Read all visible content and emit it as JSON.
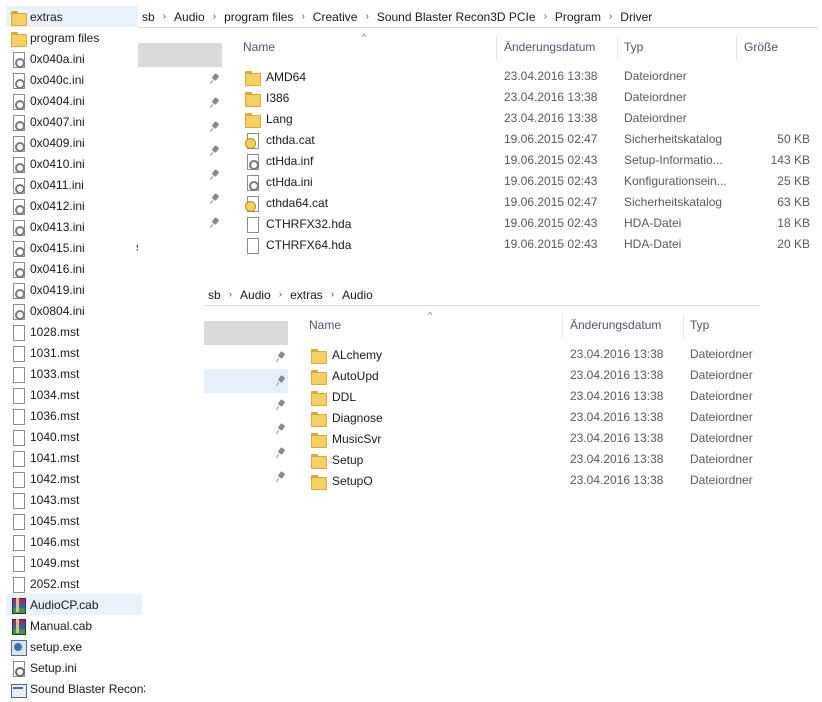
{
  "left_list": {
    "items": [
      {
        "label": "extras",
        "icon": "folder-icon",
        "selected": true
      },
      {
        "label": "program files",
        "icon": "folder-icon"
      },
      {
        "label": "0x040a.ini",
        "icon": "ini-file-icon"
      },
      {
        "label": "0x040c.ini",
        "icon": "ini-file-icon"
      },
      {
        "label": "0x0404.ini",
        "icon": "ini-file-icon"
      },
      {
        "label": "0x0407.ini",
        "icon": "ini-file-icon"
      },
      {
        "label": "0x0409.ini",
        "icon": "ini-file-icon"
      },
      {
        "label": "0x0410.ini",
        "icon": "ini-file-icon"
      },
      {
        "label": "0x0411.ini",
        "icon": "ini-file-icon"
      },
      {
        "label": "0x0412.ini",
        "icon": "ini-file-icon"
      },
      {
        "label": "0x0413.ini",
        "icon": "ini-file-icon"
      },
      {
        "label": "0x0415.ini",
        "icon": "ini-file-icon"
      },
      {
        "label": "0x0416.ini",
        "icon": "ini-file-icon"
      },
      {
        "label": "0x0419.ini",
        "icon": "ini-file-icon"
      },
      {
        "label": "0x0804.ini",
        "icon": "ini-file-icon"
      },
      {
        "label": "1028.mst",
        "icon": "document-icon"
      },
      {
        "label": "1031.mst",
        "icon": "document-icon"
      },
      {
        "label": "1033.mst",
        "icon": "document-icon"
      },
      {
        "label": "1034.mst",
        "icon": "document-icon"
      },
      {
        "label": "1036.mst",
        "icon": "document-icon"
      },
      {
        "label": "1040.mst",
        "icon": "document-icon"
      },
      {
        "label": "1041.mst",
        "icon": "document-icon"
      },
      {
        "label": "1042.mst",
        "icon": "document-icon"
      },
      {
        "label": "1043.mst",
        "icon": "document-icon"
      },
      {
        "label": "1045.mst",
        "icon": "document-icon"
      },
      {
        "label": "1046.mst",
        "icon": "document-icon"
      },
      {
        "label": "1049.mst",
        "icon": "document-icon"
      },
      {
        "label": "2052.mst",
        "icon": "document-icon"
      },
      {
        "label": "AudioCP.cab",
        "icon": "cab-archive-icon",
        "selected": true
      },
      {
        "label": "Manual.cab",
        "icon": "cab-archive-icon"
      },
      {
        "label": "setup.exe",
        "icon": "exe-icon"
      },
      {
        "label": "Setup.ini",
        "icon": "settings-file-icon"
      },
      {
        "label": "Sound Blaster Recon3",
        "icon": "application-icon"
      }
    ],
    "stray_text": "s"
  },
  "explorer_top": {
    "breadcrumb": [
      "sb",
      "Audio",
      "program files",
      "Creative",
      "Sound Blaster Recon3D PCIe",
      "Program",
      "Driver"
    ],
    "columns": {
      "name": "Name",
      "date": "Änderungsdatum",
      "type": "Typ",
      "size": "Größe"
    },
    "sort_indicator": "^",
    "rows": [
      {
        "name": "AMD64",
        "date": "23.04.2016 13:38",
        "type": "Dateiordner",
        "size": "",
        "icon": "folder-icon"
      },
      {
        "name": "I386",
        "date": "23.04.2016 13:38",
        "type": "Dateiordner",
        "size": "",
        "icon": "folder-icon"
      },
      {
        "name": "Lang",
        "date": "23.04.2016 13:38",
        "type": "Dateiordner",
        "size": "",
        "icon": "folder-icon"
      },
      {
        "name": "cthda.cat",
        "date": "19.06.2015 02:47",
        "type": "Sicherheitskatalog",
        "size": "50 KB",
        "icon": "security-catalog-icon"
      },
      {
        "name": "ctHda.inf",
        "date": "19.06.2015 02:43",
        "type": "Setup-Informatio...",
        "size": "143 KB",
        "icon": "inf-file-icon"
      },
      {
        "name": "ctHda.ini",
        "date": "19.06.2015 02:43",
        "type": "Konfigurationsein...",
        "size": "25 KB",
        "icon": "ini-file-icon"
      },
      {
        "name": "cthda64.cat",
        "date": "19.06.2015 02:47",
        "type": "Sicherheitskatalog",
        "size": "63 KB",
        "icon": "security-catalog-icon"
      },
      {
        "name": "CTHRFX32.hda",
        "date": "19.06.2015 02:43",
        "type": "HDA-Datei",
        "size": "18 KB",
        "icon": "document-icon"
      },
      {
        "name": "CTHRFX64.hda",
        "date": "19.06.2015 02:43",
        "type": "HDA-Datei",
        "size": "20 KB",
        "icon": "document-icon"
      }
    ]
  },
  "explorer_bottom": {
    "breadcrumb": [
      "sb",
      "Audio",
      "extras",
      "Audio"
    ],
    "columns": {
      "name": "Name",
      "date": "Änderungsdatum",
      "type": "Typ"
    },
    "sort_indicator": "^",
    "rows": [
      {
        "name": "ALchemy",
        "date": "23.04.2016 13:38",
        "type": "Dateiordner",
        "icon": "folder-icon"
      },
      {
        "name": "AutoUpd",
        "date": "23.04.2016 13:38",
        "type": "Dateiordner",
        "icon": "folder-icon"
      },
      {
        "name": "DDL",
        "date": "23.04.2016 13:38",
        "type": "Dateiordner",
        "icon": "folder-icon"
      },
      {
        "name": "Diagnose",
        "date": "23.04.2016 13:38",
        "type": "Dateiordner",
        "icon": "folder-icon"
      },
      {
        "name": "MusicSvr",
        "date": "23.04.2016 13:38",
        "type": "Dateiordner",
        "icon": "folder-icon"
      },
      {
        "name": "Setup",
        "date": "23.04.2016 13:38",
        "type": "Dateiordner",
        "icon": "folder-icon"
      },
      {
        "name": "SetupO",
        "date": "23.04.2016 13:38",
        "type": "Dateiordner",
        "icon": "folder-icon"
      }
    ]
  }
}
